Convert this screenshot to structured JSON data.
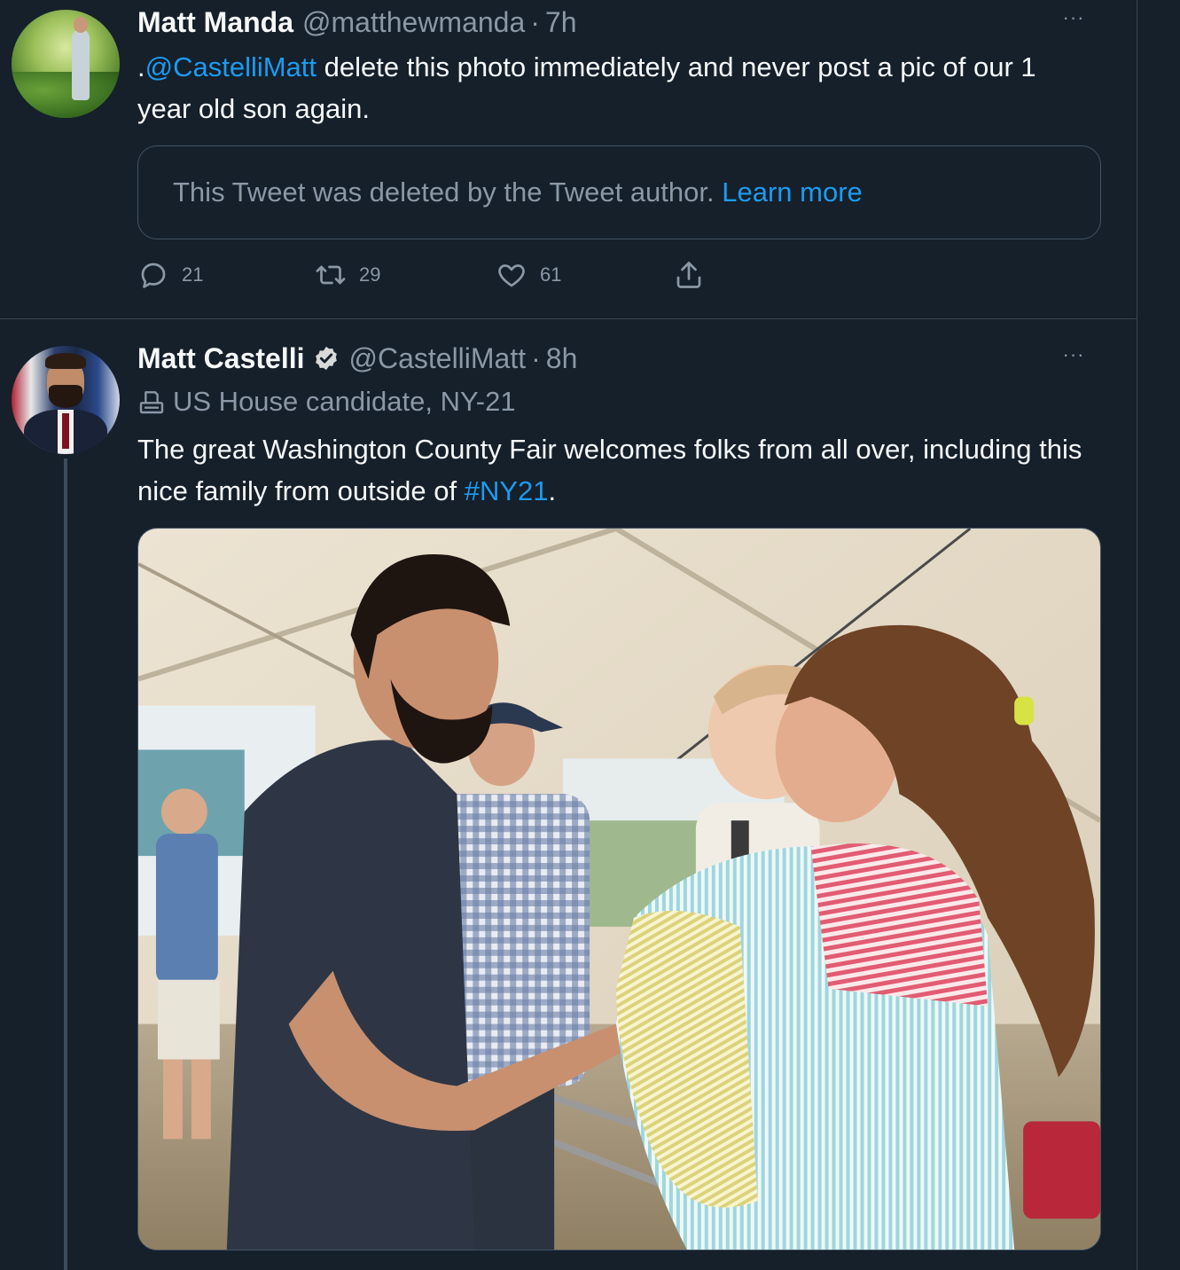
{
  "tweets": [
    {
      "author_name": "Matt Manda",
      "handle": "@matthewmanda",
      "separator": "·",
      "time": "7h",
      "more": "···",
      "text_prefix": ".",
      "mention": "@CastelliMatt",
      "text_rest": " delete this photo immediately and never post a pic of our 1 year old son again.",
      "quoted_deleted": {
        "message": "This Tweet was deleted by the Tweet author.",
        "link": "Learn more"
      },
      "actions": {
        "replies": "21",
        "retweets": "29",
        "likes": "61"
      }
    },
    {
      "author_name": "Matt Castelli",
      "verified": true,
      "handle": "@CastelliMatt",
      "separator": "·",
      "time": "8h",
      "more": "···",
      "label": "US House candidate, NY-21",
      "text_before": "The great Washington County Fair welcomes folks from all over, including this nice family from outside of ",
      "hashtag": "#NY21",
      "text_after": "."
    }
  ],
  "colors": {
    "background": "#15202b",
    "link": "#1d9bf0",
    "secondary_text": "#8b98a5",
    "border": "#38444d"
  },
  "icons": [
    "reply-icon",
    "retweet-icon",
    "like-icon",
    "share-icon",
    "verified-badge-icon",
    "ballot-box-icon",
    "more-options-icon"
  ]
}
